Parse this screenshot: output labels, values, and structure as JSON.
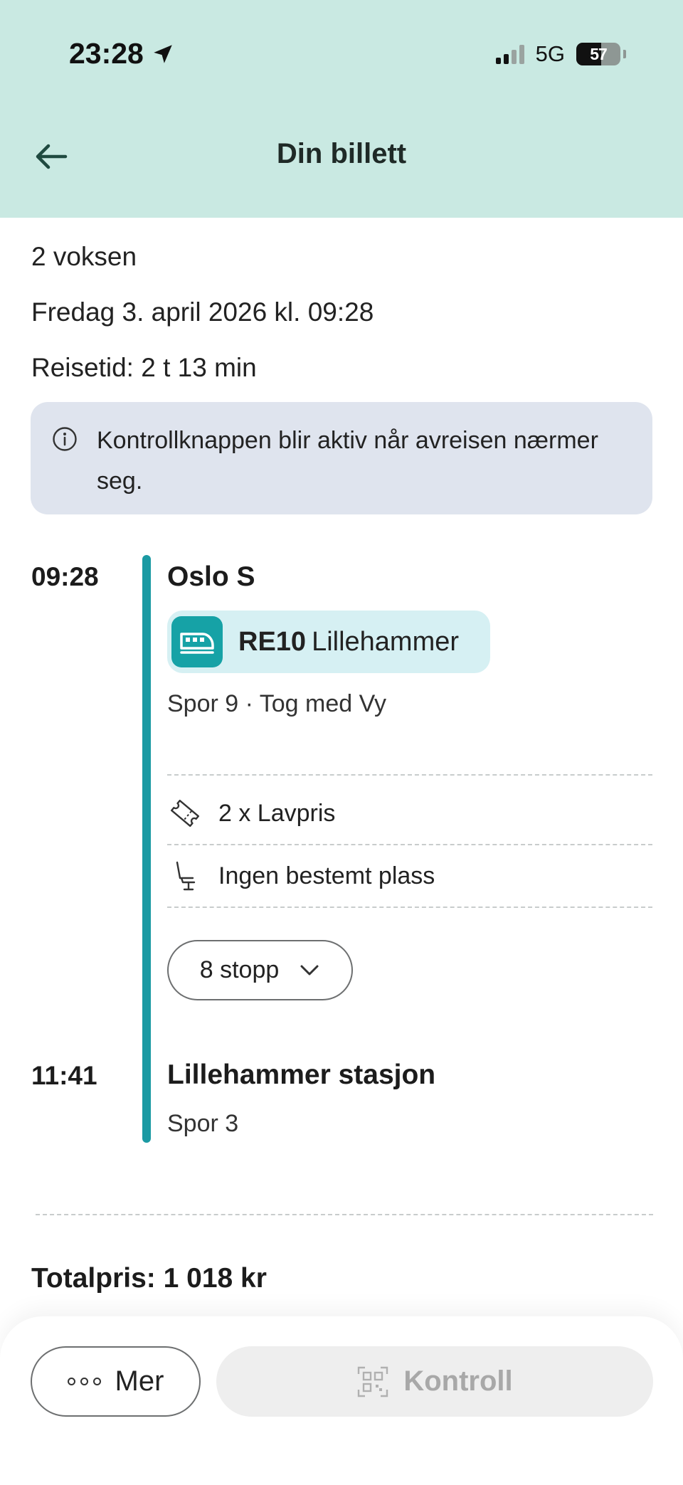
{
  "status_bar": {
    "time": "23:28",
    "network": "5G",
    "battery": "57"
  },
  "header": {
    "title": "Din billett"
  },
  "ticket": {
    "passengers": "2 voksen",
    "date": "Fredag 3. april 2026 kl. 09:28",
    "travel_time": "Reisetid: 2 t 13 min"
  },
  "notice": {
    "text": "Kontrollknappen blir aktiv når avreisen nærmer seg."
  },
  "journey": {
    "departure": {
      "time": "09:28",
      "station": "Oslo S"
    },
    "line": {
      "code": "RE10",
      "destination": "Lillehammer",
      "info": "Spor 9 · Tog med Vy"
    },
    "fare": "2 x Lavpris",
    "seat": "Ingen bestemt plass",
    "stops_label": "8 stopp",
    "arrival": {
      "time": "11:41",
      "station": "Lillehammer stasjon",
      "platform": "Spor 3"
    }
  },
  "price": {
    "total": "Totalpris: 1 018 kr"
  },
  "footer": {
    "more_label": "Mer",
    "control_label": "Kontroll"
  },
  "colors": {
    "header_bg": "#c9e9e2",
    "accent": "#1b9aa3",
    "notice_bg": "#dfe4ee",
    "chip_bg": "#d6f0f3"
  }
}
